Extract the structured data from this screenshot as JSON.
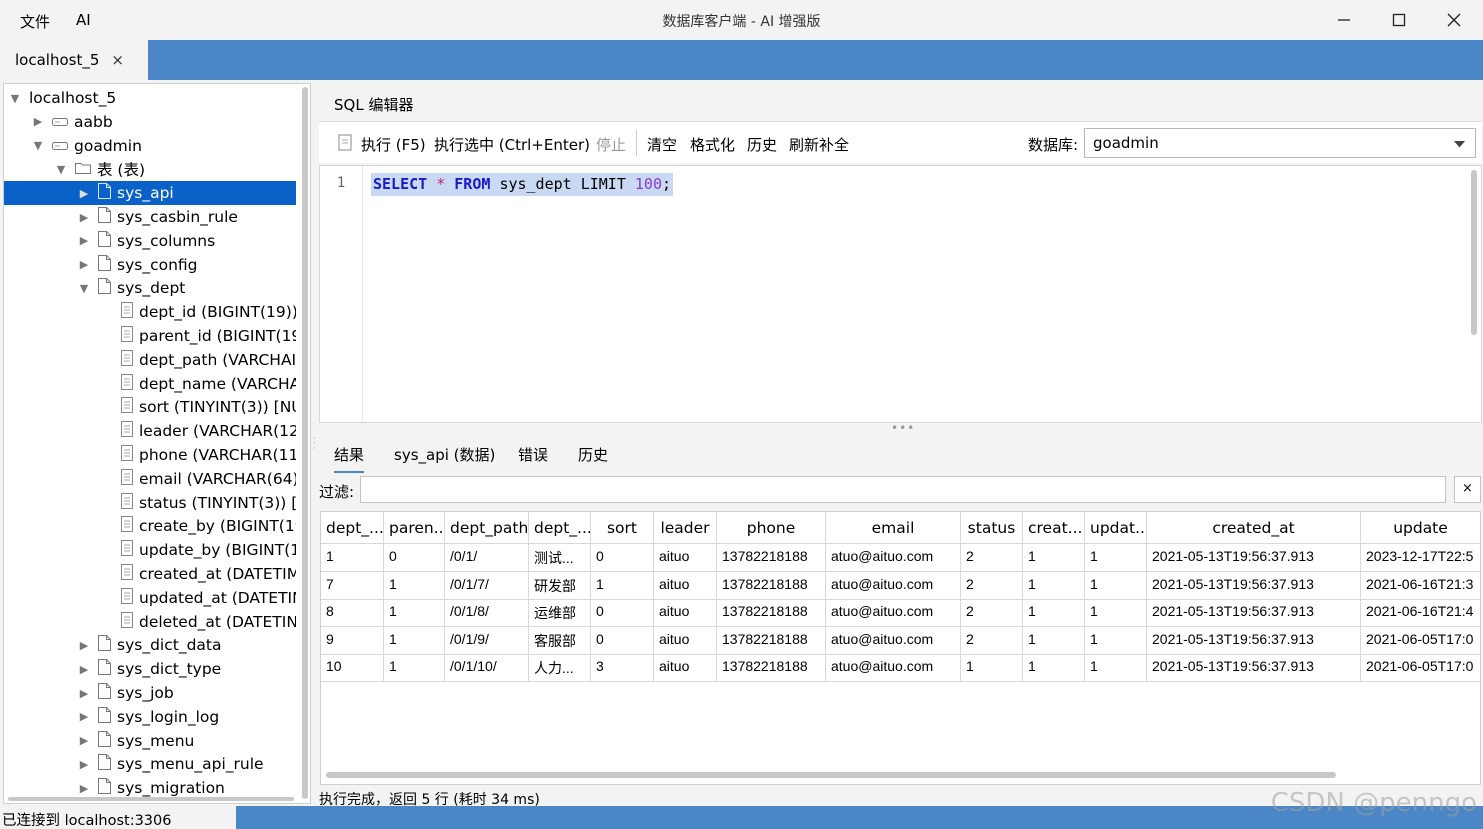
{
  "window": {
    "menu": [
      "文件",
      "AI"
    ],
    "title": "数据库客户端 - AI 增强版"
  },
  "connection_tab": {
    "label": "localhost_5",
    "close": "×"
  },
  "tree": {
    "rows": [
      {
        "label": "localhost_5",
        "indent": 0,
        "twisty": "open",
        "icon": "none"
      },
      {
        "label": "aabb",
        "indent": 1,
        "twisty": "closed",
        "icon": "database"
      },
      {
        "label": "goadmin",
        "indent": 1,
        "twisty": "open",
        "icon": "database"
      },
      {
        "label": "表 (表)",
        "indent": 2,
        "twisty": "open",
        "icon": "folder"
      },
      {
        "label": "sys_api",
        "indent": 3,
        "twisty": "closed",
        "icon": "table",
        "selected": true
      },
      {
        "label": "sys_casbin_rule",
        "indent": 3,
        "twisty": "closed",
        "icon": "table"
      },
      {
        "label": "sys_columns",
        "indent": 3,
        "twisty": "closed",
        "icon": "table"
      },
      {
        "label": "sys_config",
        "indent": 3,
        "twisty": "closed",
        "icon": "table"
      },
      {
        "label": "sys_dept",
        "indent": 3,
        "twisty": "open",
        "icon": "table"
      },
      {
        "label": "dept_id (BIGINT(19))",
        "indent": 4,
        "twisty": "none",
        "icon": "column"
      },
      {
        "label": "parent_id (BIGINT(19",
        "indent": 4,
        "twisty": "none",
        "icon": "column"
      },
      {
        "label": "dept_path (VARCHAI",
        "indent": 4,
        "twisty": "none",
        "icon": "column"
      },
      {
        "label": "dept_name (VARCHA",
        "indent": 4,
        "twisty": "none",
        "icon": "column"
      },
      {
        "label": "sort (TINYINT(3)) [NU",
        "indent": 4,
        "twisty": "none",
        "icon": "column"
      },
      {
        "label": "leader (VARCHAR(12",
        "indent": 4,
        "twisty": "none",
        "icon": "column"
      },
      {
        "label": "phone (VARCHAR(11",
        "indent": 4,
        "twisty": "none",
        "icon": "column"
      },
      {
        "label": "email (VARCHAR(64)",
        "indent": 4,
        "twisty": "none",
        "icon": "column"
      },
      {
        "label": "status (TINYINT(3)) [N",
        "indent": 4,
        "twisty": "none",
        "icon": "column"
      },
      {
        "label": "create_by (BIGINT(19",
        "indent": 4,
        "twisty": "none",
        "icon": "column"
      },
      {
        "label": "update_by (BIGINT(1!",
        "indent": 4,
        "twisty": "none",
        "icon": "column"
      },
      {
        "label": "created_at (DATETIM",
        "indent": 4,
        "twisty": "none",
        "icon": "column"
      },
      {
        "label": "updated_at (DATETIN",
        "indent": 4,
        "twisty": "none",
        "icon": "column"
      },
      {
        "label": "deleted_at (DATETIN",
        "indent": 4,
        "twisty": "none",
        "icon": "column"
      },
      {
        "label": "sys_dict_data",
        "indent": 3,
        "twisty": "closed",
        "icon": "table"
      },
      {
        "label": "sys_dict_type",
        "indent": 3,
        "twisty": "closed",
        "icon": "table"
      },
      {
        "label": "sys_job",
        "indent": 3,
        "twisty": "closed",
        "icon": "table"
      },
      {
        "label": "sys_login_log",
        "indent": 3,
        "twisty": "closed",
        "icon": "table"
      },
      {
        "label": "sys_menu",
        "indent": 3,
        "twisty": "closed",
        "icon": "table"
      },
      {
        "label": "sys_menu_api_rule",
        "indent": 3,
        "twisty": "closed",
        "icon": "table"
      },
      {
        "label": "sys_migration",
        "indent": 3,
        "twisty": "closed",
        "icon": "table"
      }
    ]
  },
  "editor": {
    "tab": "SQL 编辑器",
    "toolbar": {
      "execute": "执行 (F5)",
      "execute_selection": "执行选中 (Ctrl+Enter)",
      "stop": "停止",
      "clear": "清空",
      "format": "格式化",
      "history": "历史",
      "refresh_completion": "刷新补全",
      "database_label": "数据库:",
      "database_value": "goadmin"
    },
    "line_number": "1",
    "sql": {
      "kw1": "SELECT",
      "op": "*",
      "kw2": "FROM",
      "mid": "sys_dept LIMIT",
      "num": "100",
      "end": ";"
    }
  },
  "results": {
    "tabs": [
      "结果",
      "sys_api (数据)",
      "错误",
      "历史"
    ],
    "filter_label": "过滤:",
    "filter_value": "",
    "filter_clear": "×",
    "columns": [
      "dept_...",
      "paren...",
      "dept_path",
      "dept_...",
      "sort",
      "leader",
      "phone",
      "email",
      "status",
      "creat...",
      "updat...",
      "created_at",
      "update"
    ],
    "rows": [
      [
        "1",
        "0",
        "/0/1/",
        "测试...",
        "0",
        "aituo",
        "13782218188",
        "atuo@aituo.com",
        "2",
        "1",
        "1",
        "2021-05-13T19:56:37.913",
        "2023-12-17T22:5"
      ],
      [
        "7",
        "1",
        "/0/1/7/",
        "研发部",
        "1",
        "aituo",
        "13782218188",
        "atuo@aituo.com",
        "2",
        "1",
        "1",
        "2021-05-13T19:56:37.913",
        "2021-06-16T21:3"
      ],
      [
        "8",
        "1",
        "/0/1/8/",
        "运维部",
        "0",
        "aituo",
        "13782218188",
        "atuo@aituo.com",
        "2",
        "1",
        "1",
        "2021-05-13T19:56:37.913",
        "2021-06-16T21:4"
      ],
      [
        "9",
        "1",
        "/0/1/9/",
        "客服部",
        "0",
        "aituo",
        "13782218188",
        "atuo@aituo.com",
        "2",
        "1",
        "1",
        "2021-05-13T19:56:37.913",
        "2021-06-05T17:0"
      ],
      [
        "10",
        "1",
        "/0/1/10/",
        "人力...",
        "3",
        "aituo",
        "13782218188",
        "atuo@aituo.com",
        "1",
        "1",
        "1",
        "2021-05-13T19:56:37.913",
        "2021-06-05T17:0"
      ]
    ],
    "exec_status": "执行完成，返回 5 行 (耗时 34 ms)"
  },
  "status_bar": {
    "connection": "已连接到 localhost:3306"
  },
  "watermark": "CSDN @penngo",
  "colors": {
    "accent": "#4b86c6",
    "selection": "#0a62c9",
    "keyword": "#1a1ac9"
  }
}
